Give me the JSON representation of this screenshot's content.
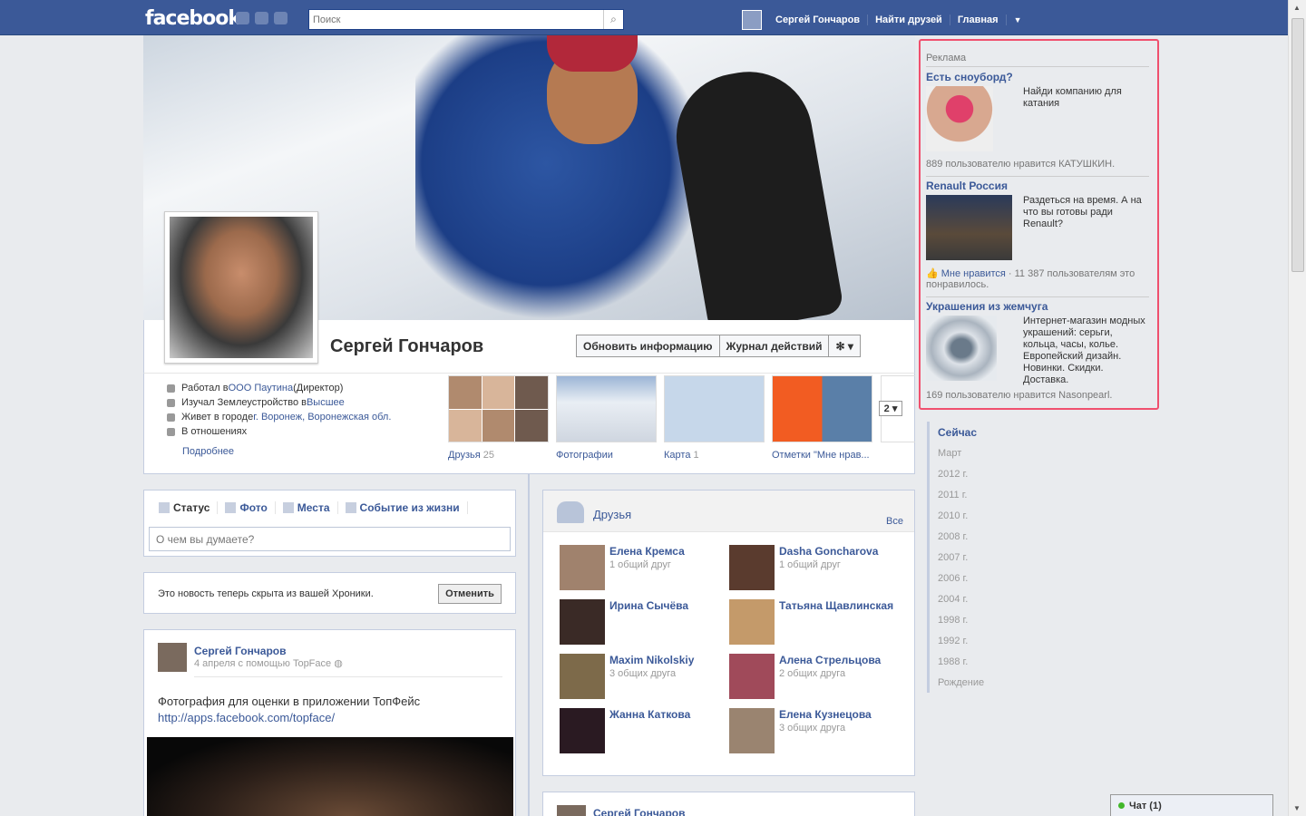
{
  "topbar": {
    "logo": "facebook",
    "search_placeholder": "Поиск",
    "user_name": "Сергей Гончаров",
    "find_friends": "Найти друзей",
    "home": "Главная"
  },
  "profile": {
    "name": "Сергей Гончаров",
    "btn_update": "Обновить информацию",
    "btn_log": "Журнал действий",
    "info": [
      {
        "pre": "Работал в ",
        "link": "ООО Паутина",
        "post": " (Директор)"
      },
      {
        "pre": "Изучал Землеустройство в ",
        "link": "Высшее",
        "post": ""
      },
      {
        "pre": "Живет в городе ",
        "link": "г. Воронеж, Воронежская обл.",
        "post": ""
      },
      {
        "pre": "В отношениях",
        "link": "",
        "post": ""
      }
    ],
    "more": "Подробнее",
    "tiles": [
      {
        "label": "Друзья",
        "count": "25"
      },
      {
        "label": "Фотографии",
        "count": ""
      },
      {
        "label": "Карта",
        "count": "1"
      },
      {
        "label": "Отметки \"Мне нрав...",
        "count": ""
      }
    ],
    "pager": "2"
  },
  "composer": {
    "tabs": [
      "Статус",
      "Фото",
      "Места",
      "Событие из жизни"
    ],
    "placeholder": "О чем вы думаете?"
  },
  "hidden_note": {
    "text": "Это новость теперь скрыта из вашей Хроники.",
    "button": "Отменить"
  },
  "post": {
    "author": "Сергей Гончаров",
    "meta": "4 апреля с помощью TopFace",
    "text": "Фотография для оценки в приложении ТопФейс",
    "link": "http://apps.facebook.com/topface/"
  },
  "friends_box": {
    "title": "Друзья",
    "all": "Все",
    "items": [
      {
        "name": "Елена Кремса",
        "mutual": "1 общий друг"
      },
      {
        "name": "Dasha Goncharova",
        "mutual": "1 общий друг"
      },
      {
        "name": "Ирина Сычёва",
        "mutual": ""
      },
      {
        "name": "Татьяна Щавлинская",
        "mutual": ""
      },
      {
        "name": "Maxim Nikolskiy",
        "mutual": "3 общих друга"
      },
      {
        "name": "Алена Стрельцова",
        "mutual": "2 общих друга"
      },
      {
        "name": "Жанна Каткова",
        "mutual": ""
      },
      {
        "name": "Елена Кузнецова",
        "mutual": "3 общих друга"
      }
    ]
  },
  "post2": {
    "author": "Сергей Гончаров"
  },
  "ads": {
    "header": "Реклама",
    "items": [
      {
        "title": "Есть сноуборд?",
        "body": "Найди компанию для катания",
        "footer": "889 пользователю нравится КАТУШКИН."
      },
      {
        "title": "Renault Россия",
        "body": "Раздеться на время. А на что вы готовы ради Renault?",
        "like": "Мне нравится",
        "footer": " · 11 387 пользователям это понравилось."
      },
      {
        "title": "Украшения из жемчуга",
        "body": "Интернет-магазин модных украшений: серьги, кольца, часы, колье. Европейский дизайн. Новинки. Скидки. Доставка.",
        "footer": "169 пользователю нравится Nasonpearl."
      }
    ]
  },
  "timeline_years": [
    "Сейчас",
    "Март",
    "2012 г.",
    "2011 г.",
    "2010 г.",
    "2008 г.",
    "2007 г.",
    "2006 г.",
    "2004 г.",
    "1998 г.",
    "1992 г.",
    "1988 г.",
    "Рождение"
  ],
  "chat": {
    "label": "Чат (1)"
  },
  "colors": {
    "brand": "#3b5998",
    "ad_highlight": "#f0506e"
  }
}
